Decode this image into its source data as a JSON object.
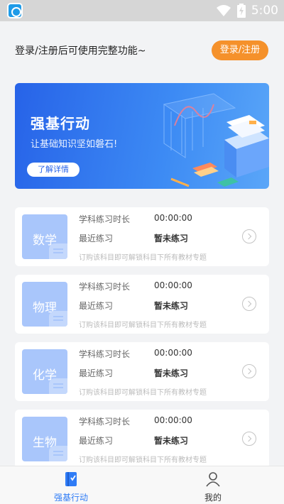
{
  "status_bar": {
    "time": "5:00",
    "icons": [
      "app-icon",
      "wifi-icon",
      "battery-charging-icon"
    ]
  },
  "login": {
    "prompt": "登录/注册后可使用完整功能~",
    "button_label": "登录/注册"
  },
  "banner": {
    "title": "强基行动",
    "subtitle": "让基础知识坚如磐石!",
    "button_label": "了解详情"
  },
  "courses": [
    {
      "subject": "数学",
      "duration_label": "学科练习时长",
      "duration_value": "00:00:00",
      "recent_label": "最近练习",
      "recent_value": "暂未练习",
      "hint": "订购该科目即可解锁科目下所有教材专题"
    },
    {
      "subject": "物理",
      "duration_label": "学科练习时长",
      "duration_value": "00:00:00",
      "recent_label": "最近练习",
      "recent_value": "暂未练习",
      "hint": "订购该科目即可解锁科目下所有教材专题"
    },
    {
      "subject": "化学",
      "duration_label": "学科练习时长",
      "duration_value": "00:00:00",
      "recent_label": "最近练习",
      "recent_value": "暂未练习",
      "hint": "订购该科目即可解锁科目下所有教材专题"
    },
    {
      "subject": "生物",
      "duration_label": "学科练习时长",
      "duration_value": "00:00:00",
      "recent_label": "最近练习",
      "recent_value": "暂未练习",
      "hint": "订购该科目即可解锁科目下所有教材专题"
    }
  ],
  "tabs": [
    {
      "label": "强基行动",
      "icon": "book-icon",
      "active": true
    },
    {
      "label": "我的",
      "icon": "person-icon",
      "active": false
    }
  ],
  "colors": {
    "accent": "#2f7cf6",
    "login_button": "#f5912b",
    "subject_tile": "#a9c6fb",
    "tab_active": "#2f7cf6",
    "tab_inactive": "#333333"
  }
}
